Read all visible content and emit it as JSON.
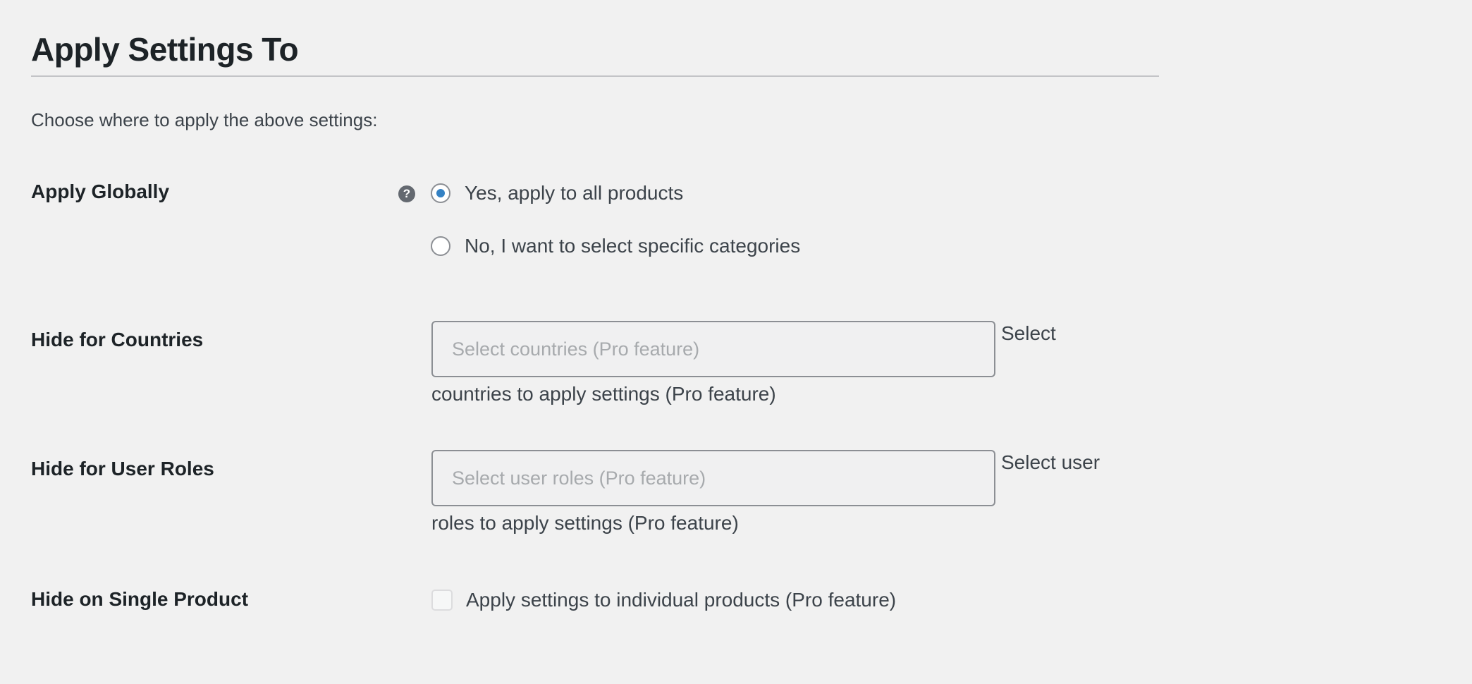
{
  "section": {
    "title": "Apply Settings To",
    "intro": "Choose where to apply the above settings:"
  },
  "apply_globally": {
    "label": "Apply Globally",
    "help_icon": "question-circle-icon",
    "help_glyph": "?",
    "options": [
      {
        "label": "Yes, apply to all products",
        "checked": true
      },
      {
        "label": "No, I want to select specific categories",
        "checked": false
      }
    ]
  },
  "hide_countries": {
    "label": "Hide for Countries",
    "placeholder": "Select countries (Pro feature)",
    "desc_line1": "Select",
    "desc_line2": "countries to apply settings (Pro feature)"
  },
  "hide_user_roles": {
    "label": "Hide for User Roles",
    "placeholder": "Select user roles (Pro feature)",
    "desc_line1": "Select user",
    "desc_line2": "roles to apply settings (Pro feature)"
  },
  "hide_single_product": {
    "label": "Hide on Single Product",
    "checkbox_label": "Apply settings to individual products (Pro feature)",
    "checked": false
  },
  "colors": {
    "background": "#f1f1f1",
    "accent": "#3582c4",
    "text": "#1d2327",
    "muted_text": "#3c434a",
    "placeholder": "#a7aaad",
    "border": "#8c8f94"
  }
}
